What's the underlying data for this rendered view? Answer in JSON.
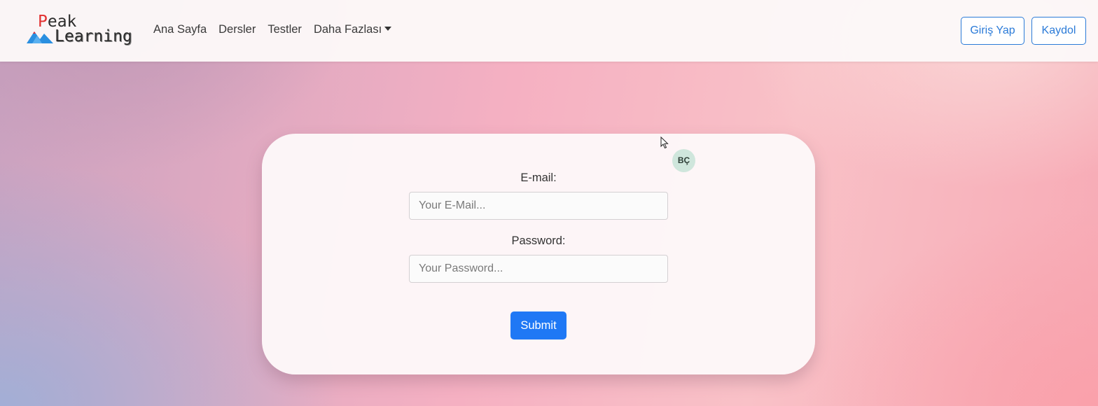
{
  "brand": {
    "logo_line1_initial": "P",
    "logo_line1_rest": "eak",
    "logo_line2": "Learning",
    "accent_color": "#e23030",
    "mountain_colors": [
      "#2a8fe0",
      "#5ab0f0"
    ]
  },
  "nav": {
    "links": [
      "Ana Sayfa",
      "Dersler",
      "Testler"
    ],
    "dropdown_label": "Daha Fazlası"
  },
  "auth": {
    "login_label": "Giriş Yap",
    "register_label": "Kaydol",
    "button_color": "#2b7bd8"
  },
  "form": {
    "avatar_initials": "BÇ",
    "email_label": "E-mail:",
    "email_placeholder": "Your E-Mail...",
    "email_value": "",
    "password_label": "Password:",
    "password_placeholder": "Your Password...",
    "password_value": "",
    "submit_label": "Submit",
    "submit_color": "#1f78f5"
  },
  "icons": {
    "dropdown": "caret-down-icon",
    "cursor": "mouse-pointer-icon",
    "logo_mark": "mountain-icon"
  }
}
